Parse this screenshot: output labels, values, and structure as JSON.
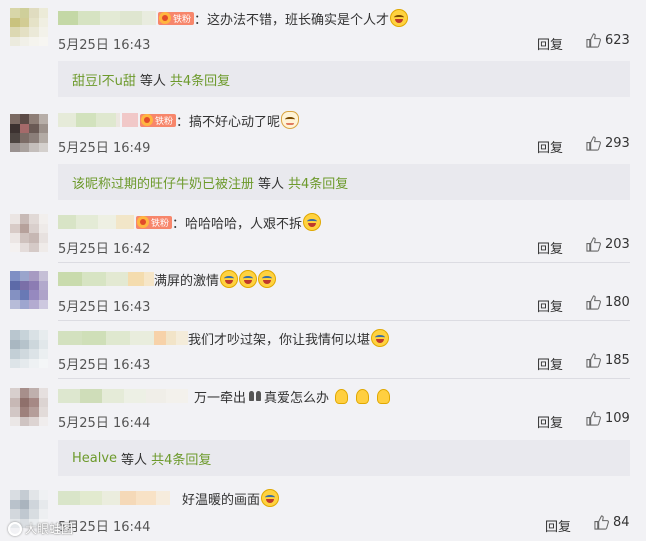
{
  "comments": [
    {
      "text": "：这办法不错，班长确实是个人才",
      "time": "5月25日 16:43",
      "reply_label": "回复",
      "likes": "623",
      "fan_badge": "铁粉",
      "subreply": {
        "user": "甜豆l不u甜",
        "suffix": "等人",
        "count": "共4条回复"
      }
    },
    {
      "text": "：搞不好心动了呢",
      "time": "5月25日 16:49",
      "reply_label": "回复",
      "likes": "293",
      "fan_badge": "铁粉",
      "subreply": {
        "user": "该昵称过期的旺仔牛奶已被注册",
        "suffix": "等人",
        "count": "共4条回复"
      }
    },
    {
      "text": "：哈哈哈哈，人艰不拆",
      "time": "5月25日 16:42",
      "reply_label": "回复",
      "likes": "203",
      "fan_badge": "铁粉"
    },
    {
      "text": "满屏的激情",
      "time": "5月25日 16:43",
      "reply_label": "回复",
      "likes": "180"
    },
    {
      "text": "我们才吵过架，你让我情何以堪",
      "time": "5月25日 16:43",
      "reply_label": "回复",
      "likes": "185"
    },
    {
      "text_a": "万一牵出",
      "text_b": "真爱怎么办",
      "time": "5月25日 16:44",
      "reply_label": "回复",
      "likes": "109",
      "subreply": {
        "user": "Healve",
        "suffix": "等人",
        "count": "共4条回复"
      }
    },
    {
      "text": "好温暖的画面",
      "time": "5月25日 16:44",
      "reply_label": "回复",
      "likes": "84"
    }
  ],
  "watermark": "大眼蛙图",
  "colors": {
    "background": "#f2f2f5",
    "subreply_bg": "#e9e9ee",
    "link_green": "#6d9a2c",
    "badge": "#f7866b"
  },
  "icons": {
    "like": "thumbs-up-icon",
    "emoji": "laughing-emoji-icon"
  }
}
